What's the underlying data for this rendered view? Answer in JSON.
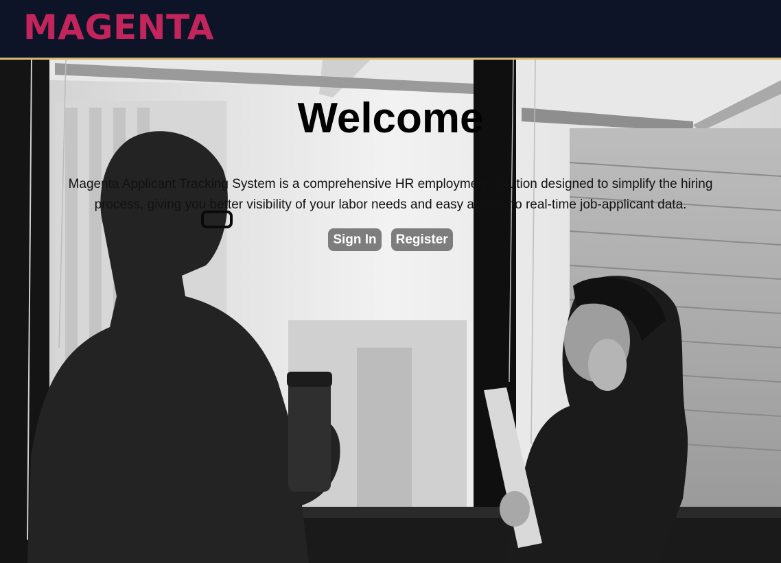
{
  "navbar": {
    "brand": "MAGENTA",
    "brand_color": "#c2255c",
    "background": "#0d1428",
    "accent_border": "#d9b97a"
  },
  "hero": {
    "title": "Welcome",
    "description": "Magenta Applicant Tracking System is a comprehensive HR employment solution designed to simplify the hiring process, giving you better visibility of your labor needs and easy access to real-time job-applicant data.",
    "background_image": "black-and-white photo of two coworkers talking by an office window",
    "buttons": {
      "sign_in_label": "Sign In",
      "register_label": "Register"
    }
  }
}
